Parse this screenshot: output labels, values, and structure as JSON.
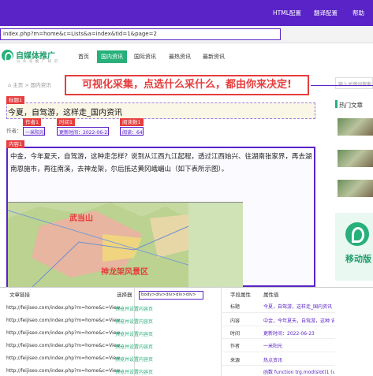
{
  "toolbar": {
    "html_config": "HTML配置",
    "translate_config": "翻译配置",
    "help": "帮助"
  },
  "address": {
    "url": "index.php?m=home&c=Lists&a=index&tid=1&page=2"
  },
  "site": {
    "brand": "自媒体推广",
    "brand_sub": "公 众 号 推 广 知 识",
    "nav": [
      "首页",
      "国内资讯",
      "国际资讯",
      "最热资讯",
      "最新资讯"
    ]
  },
  "breadcrumb": "⌂ 主页 > 国内资讯",
  "banner": "可视化采集，点选什么采什么，都由你来决定!",
  "sidebar": {
    "search_placeholder": "输入关键词搜索",
    "hot_title": "热门文章",
    "ad_text": "移动版"
  },
  "tags": {
    "title": "标题1",
    "author": "作者1",
    "time": "时间1",
    "views": "阅读数1",
    "content": "内容1"
  },
  "article": {
    "title": "今夏，自驾游，这样走_国内资讯",
    "author_label": "作者：",
    "author_value": "一米阳光",
    "time_value": "更新时间：2022-06-23",
    "views_value": "阅读：64",
    "paragraph": "中金，今年夏天，自驾游，这种走怎样？说到从江西九江起程，透过江西始兴、往湖南张家界，再去湖南恩施市，再往南溪，去神龙架，尔后抵达黄冈峨嵋山（如下表所示图）。",
    "map_label_1": "武当山",
    "map_label_2": "神龙架风景区"
  },
  "panel": {
    "col_link": "文章链接",
    "col_selector": "选择器",
    "selector_value": "body>div>div>div>div>",
    "col_attr": "字段属性",
    "col_value": "属性值",
    "links": [
      "http://feijiseo.com/index.php?m=home&c=View...",
      "http://feijiseo.com/index.php?m=home&c=View...",
      "http://feijiseo.com/index.php?m=home&c=View...",
      "http://feijiseo.com/index.php?m=home&c=View...",
      "http://feijiseo.com/index.php?m=home&c=View...",
      "http://feijiseo.com/index.php?m=home&c=View...",
      "http://feijiseo.com/index.php?m=home&c=View..."
    ],
    "actions": [
      "预览并设置内容页",
      "预览并设置内容页",
      "预览并设置内容页",
      "预览并设置内容页",
      "预览并设置内容页",
      "预览并设置内容页",
      "预览并设置内容页"
    ],
    "attr_rows": [
      {
        "name": "标题",
        "value": "今夏，自驾游，这样走_国内资讯"
      },
      {
        "name": "内容",
        "value": "中金，今年夏天，自驾游，这种 说到从江西九江..."
      },
      {
        "name": "时间",
        "value": "更新时间：2022-06-23"
      },
      {
        "name": "作者",
        "value": "一米阳光"
      },
      {
        "name": "来源",
        "value": "热点资讯"
      },
      {
        "name": "",
        "value": "函数 function trg.mod(slot)1 (var slot = 3;if(..."
      }
    ]
  },
  "colors": {
    "accent": "#5a23c8",
    "brand": "#27b07a",
    "alert": "#e63d3d"
  }
}
